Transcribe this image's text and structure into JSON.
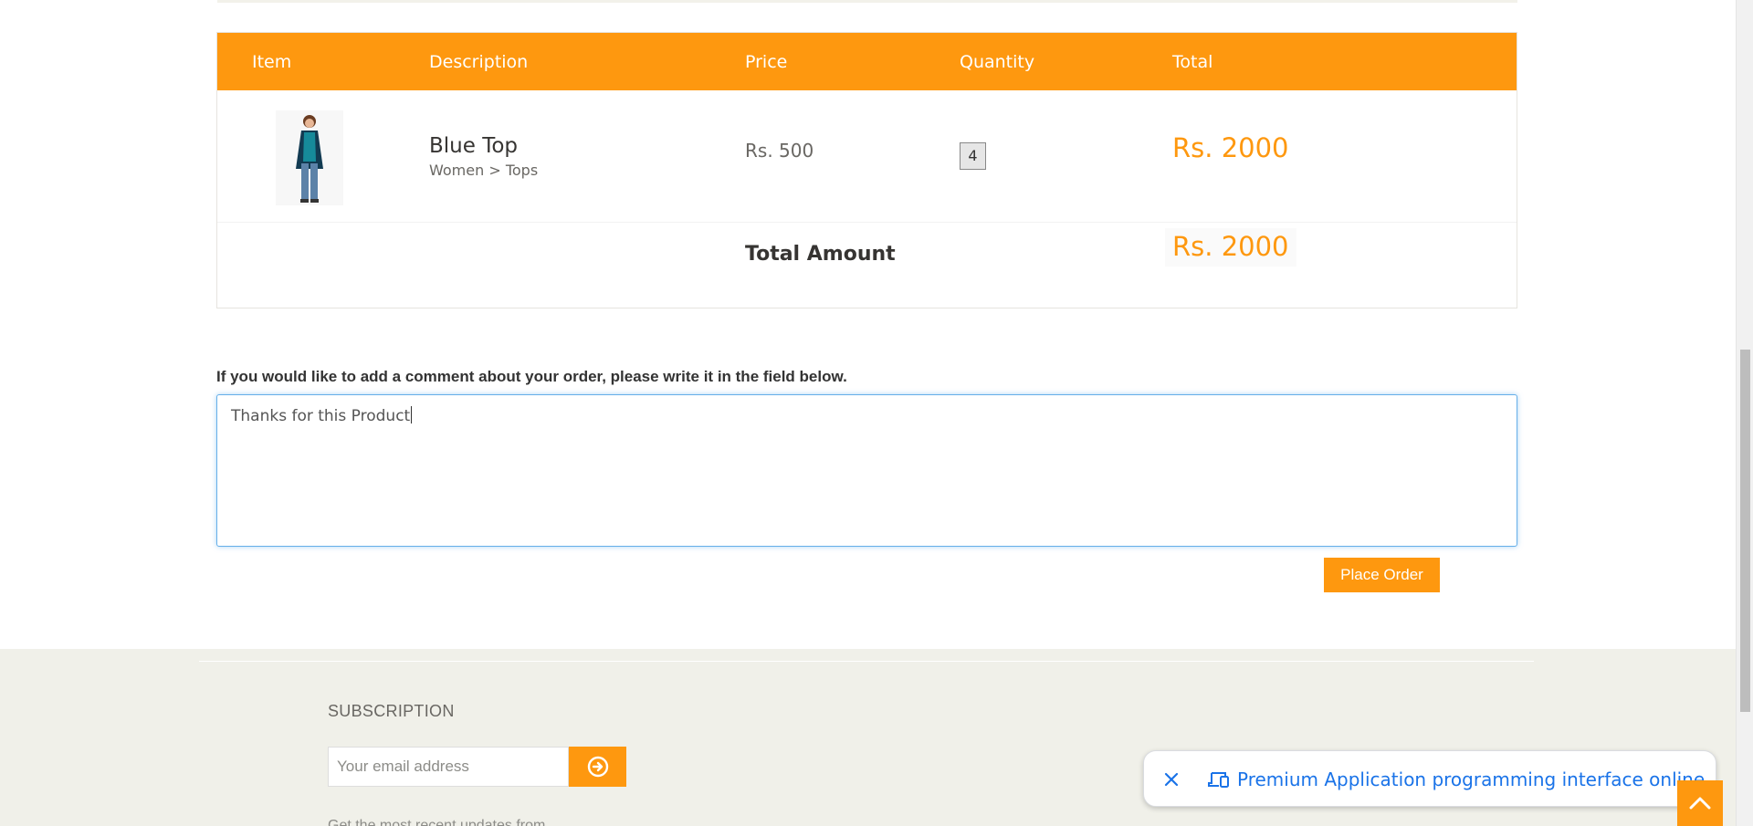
{
  "cart": {
    "headers": {
      "item": "Item",
      "description": "Description",
      "price": "Price",
      "quantity": "Quantity",
      "total": "Total"
    },
    "items": [
      {
        "name": "Blue Top",
        "category": "Women > Tops",
        "price": "Rs. 500",
        "quantity": "4",
        "total": "Rs. 2000"
      }
    ],
    "total_label": "Total Amount",
    "total_amount": "Rs. 2000"
  },
  "comment": {
    "label": "If you would like to add a comment about your order, please write it in the field below.",
    "value": "Thanks for this Product"
  },
  "actions": {
    "place_order": "Place Order"
  },
  "footer": {
    "subscription_title": "SUBSCRIPTION",
    "email_placeholder": "Your email address",
    "subscription_text": "Get the most recent updates from"
  },
  "toast": {
    "link_text": "Premium Application programming interface online"
  },
  "icons": {
    "subscribe": "arrow-circle-right-icon",
    "toast_close": "close-icon",
    "toast_device": "devices-icon",
    "scroll_up": "chevron-up-icon"
  },
  "colors": {
    "accent": "#fe980f",
    "link": "#1a73e8",
    "footer_bg": "#f0f0e9"
  }
}
